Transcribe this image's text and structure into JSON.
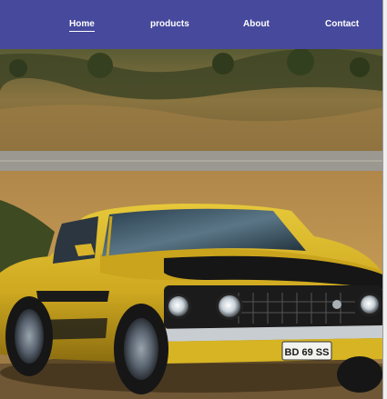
{
  "nav": {
    "items": [
      {
        "label": "Home",
        "active": true
      },
      {
        "label": "products",
        "active": false
      },
      {
        "label": "About",
        "active": false
      },
      {
        "label": "Contact",
        "active": false
      }
    ]
  },
  "hero": {
    "image": "yellow-muscle-car-photo",
    "plate_text": "BD 69 SS"
  },
  "colors": {
    "navbar": "#46499c",
    "nav_text": "#ffffff",
    "car_body": "#d6b423",
    "hood_stripe": "#161616"
  }
}
